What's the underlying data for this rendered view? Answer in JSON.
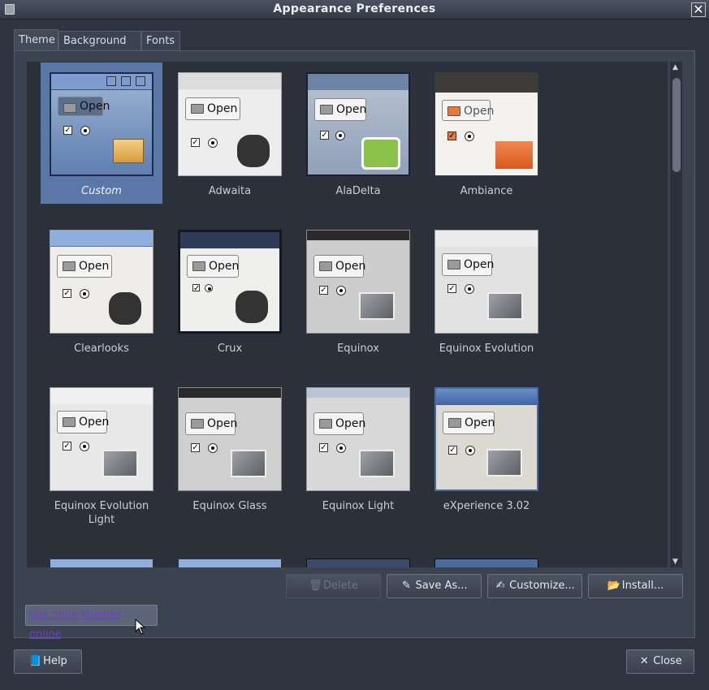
{
  "window": {
    "title": "Appearance Preferences"
  },
  "tabs": [
    {
      "label": "Theme"
    },
    {
      "label": "Background"
    },
    {
      "label": "Fonts"
    }
  ],
  "themes": [
    {
      "name": "Custom",
      "open": "Open"
    },
    {
      "name": "Adwaita",
      "open": "Open"
    },
    {
      "name": "AlaDelta",
      "open": "Open"
    },
    {
      "name": "Ambiance",
      "open": "Open"
    },
    {
      "name": "Clearlooks",
      "open": "Open"
    },
    {
      "name": "Crux",
      "open": "Open"
    },
    {
      "name": "Equinox",
      "open": "Open"
    },
    {
      "name": "Equinox Evolution",
      "open": "Open"
    },
    {
      "name": "Equinox Evolution Light",
      "open": "Open"
    },
    {
      "name": "Equinox Glass",
      "open": "Open"
    },
    {
      "name": "Equinox Light",
      "open": "Open"
    },
    {
      "name": "eXperience 3.02",
      "open": "Open"
    }
  ],
  "actions": {
    "delete": "Delete",
    "save_as": "Save As...",
    "customize": "Customize...",
    "install": "Install..."
  },
  "link": {
    "more_themes": "Get more themes online"
  },
  "footer": {
    "help": "Help",
    "close": "Close"
  }
}
